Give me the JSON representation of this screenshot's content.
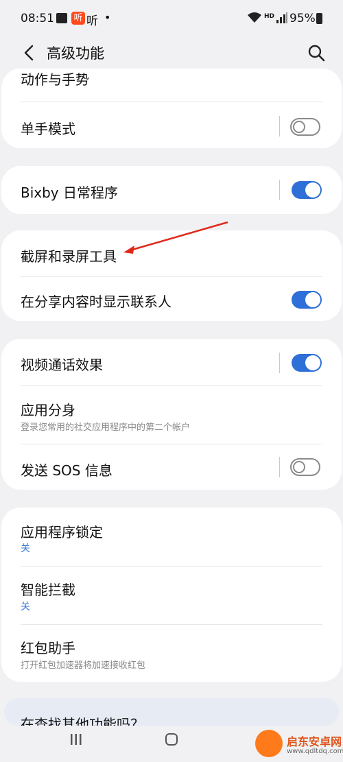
{
  "status": {
    "time": "08:51",
    "app_icon_text": "听",
    "app_label": "听",
    "dot": "•",
    "hd": "HD",
    "battery": "95%"
  },
  "appbar": {
    "title": "高级功能"
  },
  "sections": [
    {
      "items": [
        {
          "label": "动作与手势"
        },
        {
          "label": "单手模式",
          "toggle": "off"
        }
      ]
    },
    {
      "items": [
        {
          "label": "Bixby 日常程序",
          "toggle": "on"
        }
      ]
    },
    {
      "items": [
        {
          "label": "截屏和录屏工具"
        },
        {
          "label": "在分享内容时显示联系人",
          "toggle": "on"
        }
      ]
    },
    {
      "items": [
        {
          "label": "视频通话效果",
          "toggle": "on"
        },
        {
          "label": "应用分身",
          "subtitle": "登录您常用的社交应用程序中的第二个帐户"
        },
        {
          "label": "发送 SOS 信息",
          "toggle": "off"
        }
      ]
    },
    {
      "items": [
        {
          "label": "应用程序锁定",
          "subtitle": "关"
        },
        {
          "label": "智能拦截",
          "subtitle": "关"
        },
        {
          "label": "红包助手",
          "subtitle": "打开红包加速器将加速接收红包"
        }
      ]
    }
  ],
  "more": {
    "label": "在查找其他功能吗？"
  },
  "watermark": {
    "name": "启东安卓网",
    "url": "www.qdltdq.com"
  },
  "colors": {
    "accent": "#2e6fd8",
    "background": "#f1f1f3",
    "arrow": "#e0291b"
  }
}
